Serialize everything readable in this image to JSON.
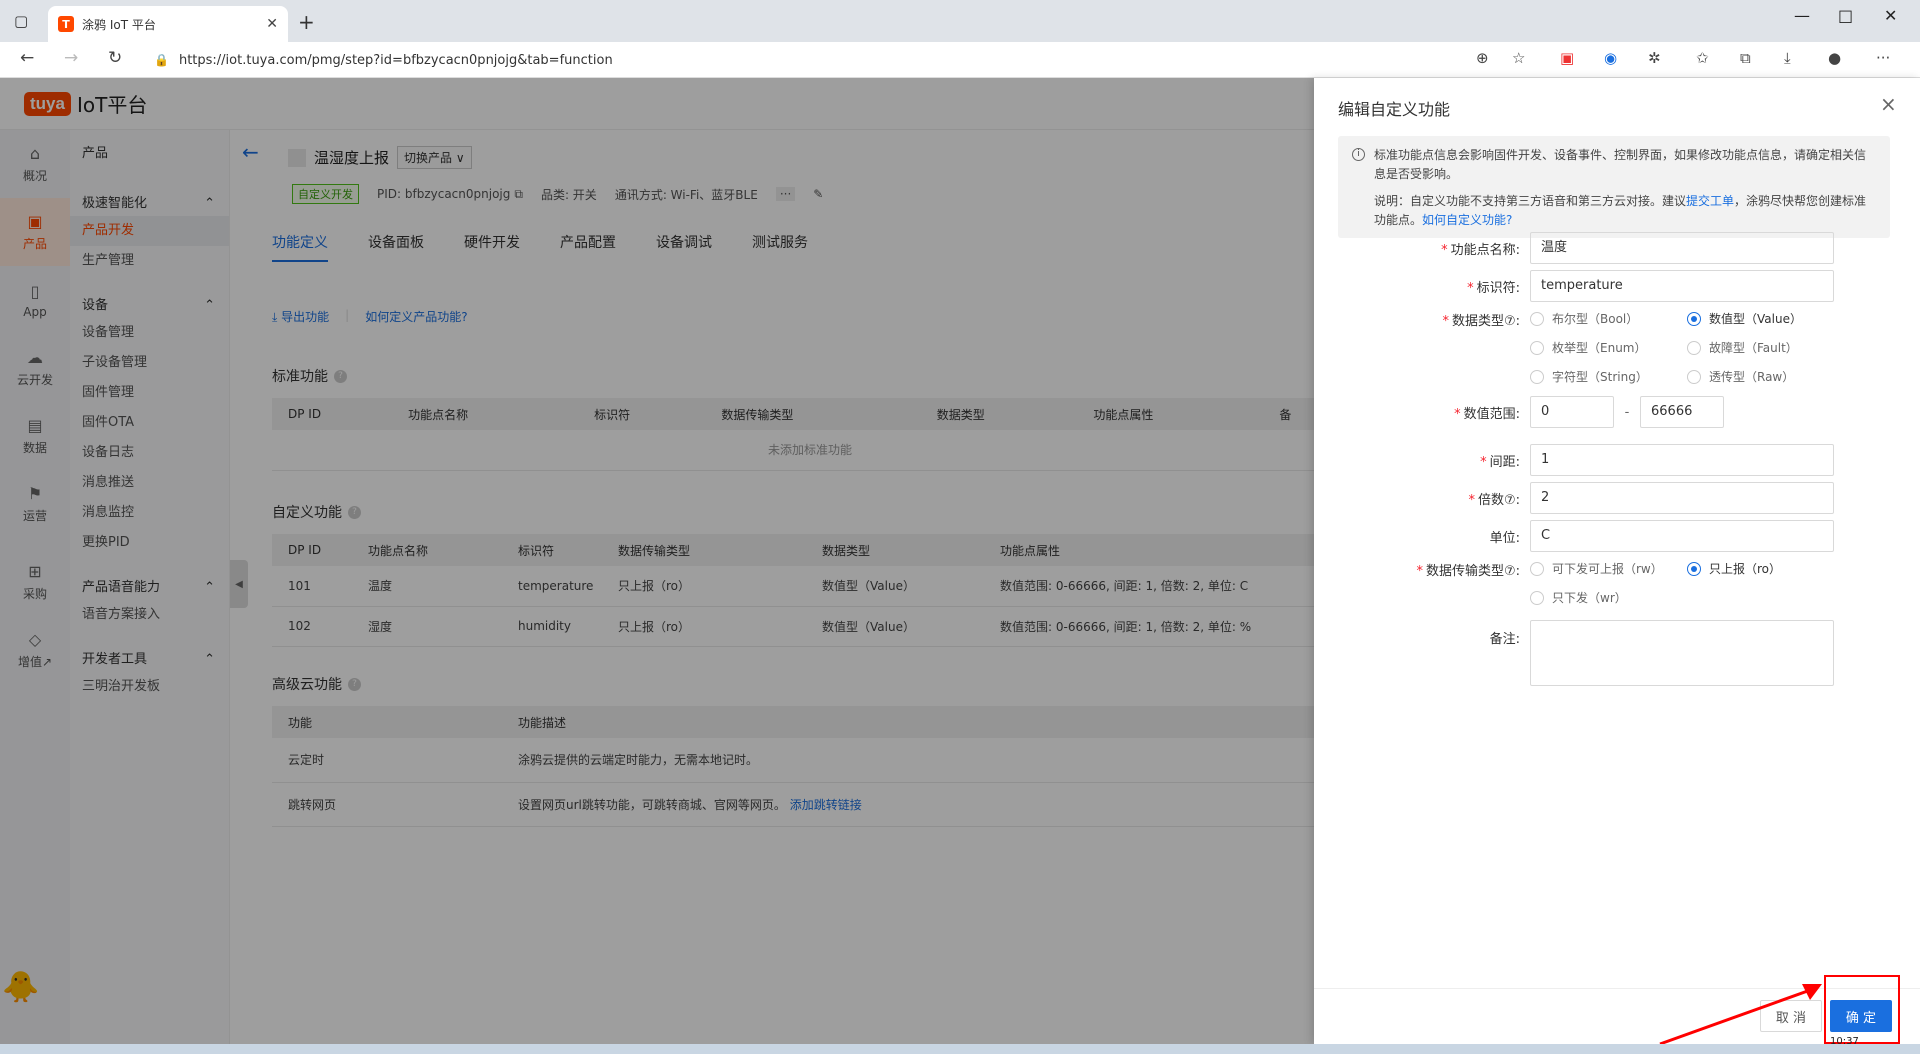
{
  "browser": {
    "tab_title": "涂鸦 IoT 平台",
    "tab_favicon": "T",
    "url": "https://iot.tuya.com/pmg/step?id=bfbzycacn0pnjojg&tab=function",
    "new_tab": "+"
  },
  "brand": {
    "logo": "tuya",
    "title": "IoT平台"
  },
  "leftnav": [
    {
      "icon": "⌂",
      "label": "概况"
    },
    {
      "icon": "▣",
      "label": "产品"
    },
    {
      "icon": "▯",
      "label": "App"
    },
    {
      "icon": "☁",
      "label": "云开发"
    },
    {
      "icon": "▤",
      "label": "数据"
    },
    {
      "icon": "⚑",
      "label": "运营"
    },
    {
      "icon": "⊞",
      "label": "采购"
    },
    {
      "icon": "◇",
      "label": "增值↗"
    }
  ],
  "subnav": {
    "header": "产品",
    "groups": [
      {
        "title": "极速智能化",
        "items": [
          "产品开发",
          "生产管理"
        ]
      },
      {
        "title": "设备",
        "items": [
          "设备管理",
          "子设备管理",
          "固件管理",
          "固件OTA",
          "设备日志",
          "消息推送",
          "消息监控",
          "更换PID"
        ]
      },
      {
        "title": "产品语音能力",
        "items": [
          "语音方案接入"
        ]
      },
      {
        "title": "开发者工具",
        "items": [
          "三明治开发板"
        ]
      }
    ]
  },
  "product": {
    "name": "温湿度上报",
    "switch": "切换产品 ∨",
    "tag": "自定义开发",
    "pid": "PID: bfbzycacn0pnjojg",
    "category": "品类: 开关",
    "comm": "通讯方式: Wi-Fi、蓝牙BLE",
    "more": "···"
  },
  "tabs": [
    "功能定义",
    "设备面板",
    "硬件开发",
    "产品配置",
    "设备调试",
    "测试服务"
  ],
  "actions": {
    "export": "导出功能",
    "how": "如何定义产品功能?"
  },
  "standard": {
    "title": "标准功能",
    "headers": [
      "DP ID",
      "功能点名称",
      "标识符",
      "数据传输类型",
      "数据类型",
      "功能点属性",
      "备"
    ],
    "empty": "未添加标准功能"
  },
  "custom": {
    "title": "自定义功能",
    "headers": [
      "DP ID",
      "功能点名称",
      "标识符",
      "数据传输类型",
      "数据类型",
      "功能点属性"
    ],
    "rows": [
      [
        "101",
        "温度",
        "temperature",
        "只上报（ro）",
        "数值型（Value）",
        "数值范围: 0-66666, 间距: 1, 倍数: 2, 单位: C"
      ],
      [
        "102",
        "湿度",
        "humidity",
        "只上报（ro）",
        "数值型（Value）",
        "数值范围: 0-66666, 间距: 1, 倍数: 2, 单位: %"
      ]
    ]
  },
  "advanced": {
    "title": "高级云功能",
    "headers": [
      "功能",
      "功能描述"
    ],
    "rows": [
      [
        "云定时",
        "涂鸦云提供的云端定时能力，无需本地记时。",
        ""
      ],
      [
        "跳转网页",
        "设置网页url跳转功能，可跳转商城、官网等网页。",
        "添加跳转链接"
      ]
    ]
  },
  "drawer": {
    "title": "编辑自定义功能",
    "close": "×",
    "notice_1": "标准功能点信息会影响固件开发、设备事件、控制界面，如果修改功能点信息，请确定相关信息是否受影响。",
    "notice_2a": "说明：自定义功能不支持第三方语音和第三方云对接。建议",
    "notice_2_link1": "提交工单",
    "notice_2b": "，涂鸦尽快帮您创建标准功能点。",
    "notice_2_link2": "如何自定义功能?",
    "fields": {
      "name_label": "功能点名称:",
      "name_value": "温度",
      "id_label": "标识符:",
      "id_value": "temperature",
      "dtype_label": "数据类型⑦:",
      "dtypes": [
        "布尔型（Bool）",
        "数值型（Value）",
        "枚举型（Enum）",
        "故障型（Fault）",
        "字符型（String）",
        "透传型（Raw）"
      ],
      "range_label": "数值范围:",
      "range_min": "0",
      "range_sep": "-",
      "range_max": "66666",
      "step_label": "间距:",
      "step_value": "1",
      "scale_label": "倍数⑦:",
      "scale_value": "2",
      "unit_label": "单位:",
      "unit_value": "C",
      "trans_label": "数据传输类型⑦:",
      "trans": [
        "可下发可上报（rw）",
        "只上报（ro）",
        "只下发（wr）"
      ],
      "remark_label": "备注:"
    },
    "cancel": "取 消",
    "ok": "确 定"
  },
  "taskbar": {
    "time": "10:37"
  }
}
